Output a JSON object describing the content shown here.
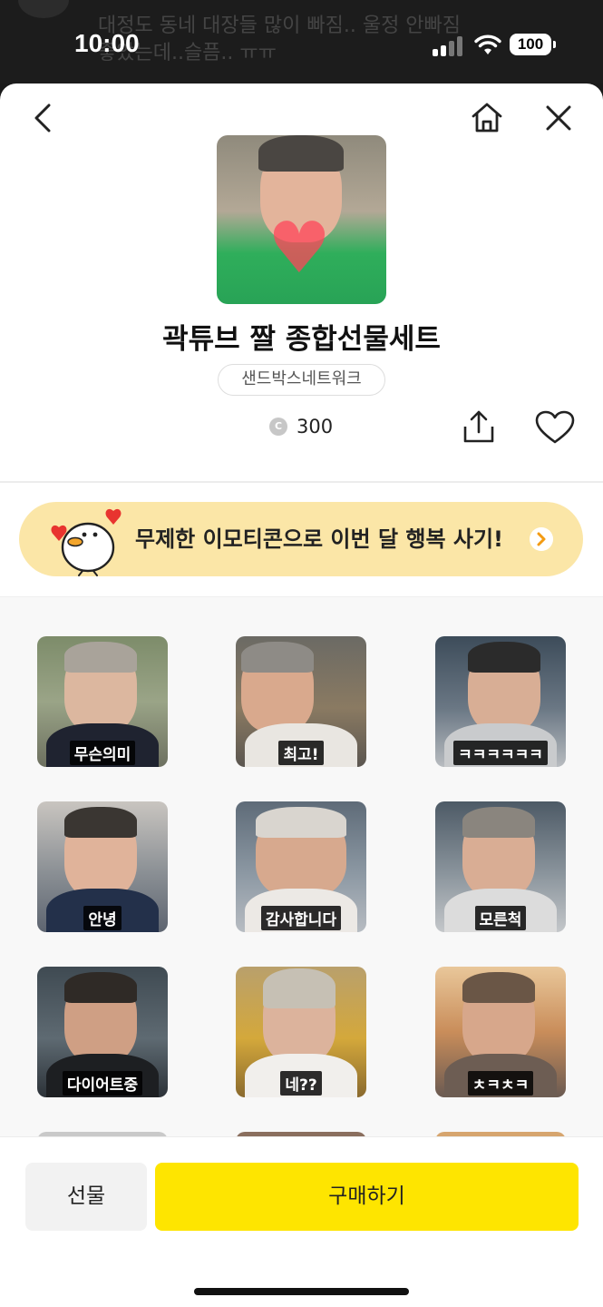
{
  "status_bar": {
    "time": "10:00",
    "battery": "100",
    "background_text": "대정도 동네 대장들 많이 빠짐.. 울정 안빠짐\n좋았는데..슬픔.. ㅠㅠ"
  },
  "nav": {
    "back_icon": "chevron-left-icon",
    "home_icon": "home-icon",
    "close_icon": "close-icon"
  },
  "product": {
    "title": "곽튜브 짤 종합선물세트",
    "author": "샌드박스네트워크",
    "coin_symbol": "C",
    "price": "300"
  },
  "promo": {
    "text": "무제한 이모티콘으로 이번 달 행복 사기!"
  },
  "emoticons": [
    {
      "caption": "무슨의미"
    },
    {
      "caption": "최고!"
    },
    {
      "caption": "ㅋㅋㅋㅋㅋㅋ"
    },
    {
      "caption": "안녕"
    },
    {
      "caption": "감사합니다"
    },
    {
      "caption": "모른척"
    },
    {
      "caption": "다이어트중"
    },
    {
      "caption": "네??"
    },
    {
      "caption": "ㅊㅋㅊㅋ"
    }
  ],
  "actions": {
    "gift_label": "선물",
    "buy_label": "구매하기"
  },
  "colors": {
    "buy_button": "#fee500",
    "promo_banner": "#fbe6a7",
    "gift_button": "#f2f2f2"
  }
}
